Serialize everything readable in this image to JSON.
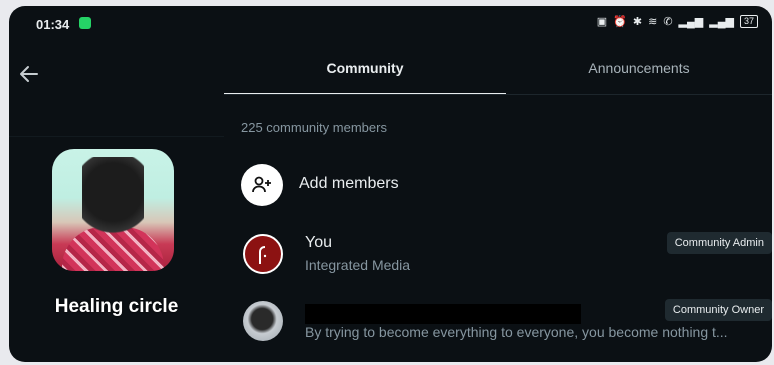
{
  "status_bar": {
    "time": "01:34",
    "battery": "37"
  },
  "community": {
    "name": "Healing circle"
  },
  "tabs": [
    {
      "label": "Community",
      "active": true
    },
    {
      "label": "Announcements",
      "active": false
    }
  ],
  "members_count": "225 community members",
  "add_members_label": "Add members",
  "members": [
    {
      "name": "You",
      "subtitle": "Integrated Media",
      "badge": "Community Admin"
    },
    {
      "name": "",
      "subtitle": "By trying to become everything to everyone, you become nothing t...",
      "badge": "Community Owner"
    }
  ],
  "colors": {
    "background": "#0b1014",
    "admin_avatar": "#8c1212",
    "text": "#e9edef",
    "muted": "#8696a0"
  }
}
